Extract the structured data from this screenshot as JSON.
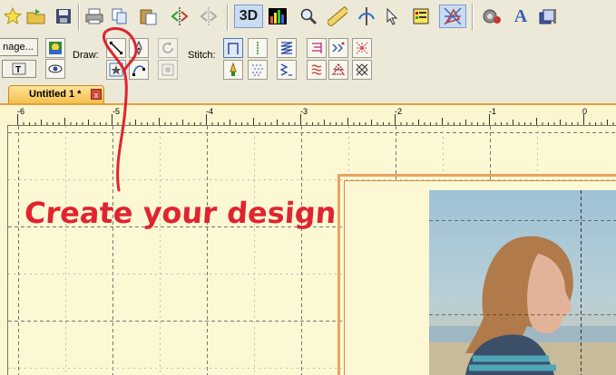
{
  "toolbar": {
    "icons": [
      "star-new-icon",
      "open-folder-icon",
      "save-icon",
      "print-icon",
      "copy-icon",
      "paste-icon",
      "mirror-icon",
      "mirror-disabled-icon",
      "3d-view-icon",
      "color-bars-icon",
      "magnifier-icon",
      "ruler-icon",
      "needle-icon",
      "pointer-icon",
      "color-list-icon",
      "stitch-select-icon",
      "settings-icon",
      "font-a-icon",
      "windows-icon"
    ],
    "three_d_label": "3D",
    "font_a_label": "A"
  },
  "toolbar2": {
    "image_button_label": "nage...",
    "draw_label": "Draw:",
    "stitch_label": "Stitch:"
  },
  "tabs": [
    {
      "label": "Untitled 1 *",
      "close": "x"
    }
  ],
  "ruler": {
    "labels": [
      "-6",
      "-5",
      "-4",
      "-3",
      "-2",
      "-1",
      "0"
    ]
  },
  "annotation": {
    "text": "Create your design",
    "color": "#e0242f"
  },
  "colors": {
    "canvas": "#fdf8d4",
    "tab_active": "#f6c04c",
    "frame": "#e8a460"
  }
}
